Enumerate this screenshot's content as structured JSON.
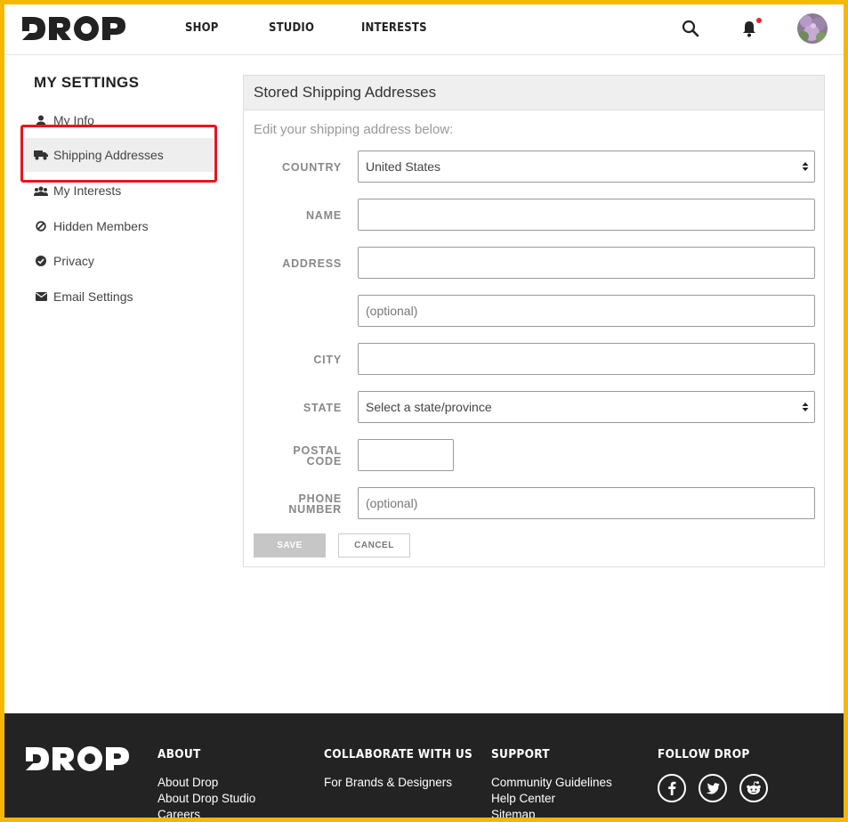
{
  "header": {
    "nav": [
      "SHOP",
      "STUDIO",
      "INTERESTS"
    ]
  },
  "sidebar": {
    "title": "MY SETTINGS",
    "items": [
      {
        "label": "My Info",
        "icon": "user-icon"
      },
      {
        "label": "Shipping Addresses",
        "icon": "truck-icon"
      },
      {
        "label": "My Interests",
        "icon": "group-icon"
      },
      {
        "label": "Hidden Members",
        "icon": "ban-icon"
      },
      {
        "label": "Privacy",
        "icon": "check-circle-icon"
      },
      {
        "label": "Email Settings",
        "icon": "envelope-icon"
      }
    ],
    "active_index": 1
  },
  "panel": {
    "title": "Stored Shipping Addresses",
    "subtitle": "Edit your shipping address below:",
    "fields": {
      "country": {
        "label": "COUNTRY",
        "value": "United States"
      },
      "name": {
        "label": "NAME",
        "value": ""
      },
      "address": {
        "label": "ADDRESS",
        "value": ""
      },
      "address2": {
        "placeholder": "(optional)"
      },
      "city": {
        "label": "CITY",
        "value": ""
      },
      "state": {
        "label": "STATE",
        "value": "Select a state/province"
      },
      "postal": {
        "label1": "POSTAL",
        "label2": "CODE",
        "value": ""
      },
      "phone": {
        "label1": "PHONE",
        "label2": "NUMBER",
        "placeholder": "(optional)"
      }
    },
    "save_label": "SAVE",
    "cancel_label": "CANCEL"
  },
  "footer": {
    "about": {
      "title": "ABOUT",
      "links": [
        "About Drop",
        "About Drop Studio",
        "Careers"
      ]
    },
    "collaborate": {
      "title": "COLLABORATE WITH US",
      "links": [
        "For Brands & Designers"
      ]
    },
    "support": {
      "title": "SUPPORT",
      "links": [
        "Community Guidelines",
        "Help Center",
        "Sitemap"
      ]
    },
    "follow": {
      "title": "FOLLOW DROP",
      "icons": [
        "facebook-icon",
        "twitter-icon",
        "reddit-icon"
      ]
    }
  },
  "colors": {
    "accent": "#f5b800",
    "highlight": "#e8141e",
    "footer_bg": "#232323",
    "notification": "#e2262f"
  }
}
